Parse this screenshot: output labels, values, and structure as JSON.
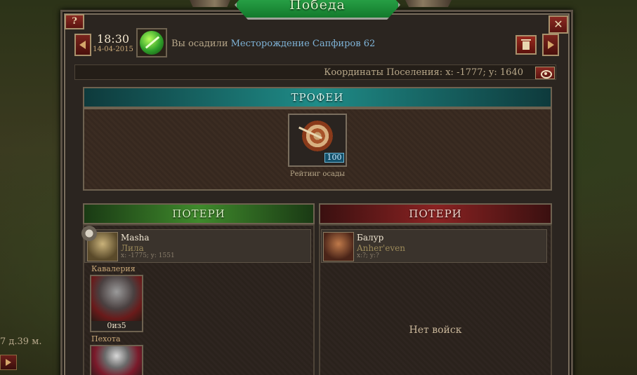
{
  "map": {
    "left_label": "7 д.39 м."
  },
  "window": {
    "title": "Победа",
    "help_label": "?",
    "close_label": "✕"
  },
  "header": {
    "time": "18:30",
    "date": "14-04-2015",
    "message_prefix": "Вы осадили",
    "message_target": "Месторождение Сапфиров 62",
    "coordinates": "Координаты Поселения: x: -1777; y: 1640"
  },
  "trophies": {
    "title": "ТРОФЕИ",
    "item_count": "100",
    "item_label": "Рейтинг осады"
  },
  "losses_attacker": {
    "title": "ПОТЕРИ",
    "player_name": "Masha",
    "alliance": "Лила",
    "coords": "x: -1775; y: 1551",
    "cavalry_label": "Кавалерия",
    "cavalry_count": "0из5",
    "infantry_label": "Пехота"
  },
  "losses_defender": {
    "title": "ПОТЕРИ",
    "player_name": "Балур",
    "alliance": "Anher'even",
    "coords": "x:?; y:?",
    "no_troops": "Нет войск"
  },
  "colors": {
    "victory_green": "#1f9a3c",
    "trophy_teal": "#1f8c88",
    "attacker_green": "#3f8a2c",
    "defender_red": "#8a2222",
    "link_blue": "#7fb4d8"
  }
}
